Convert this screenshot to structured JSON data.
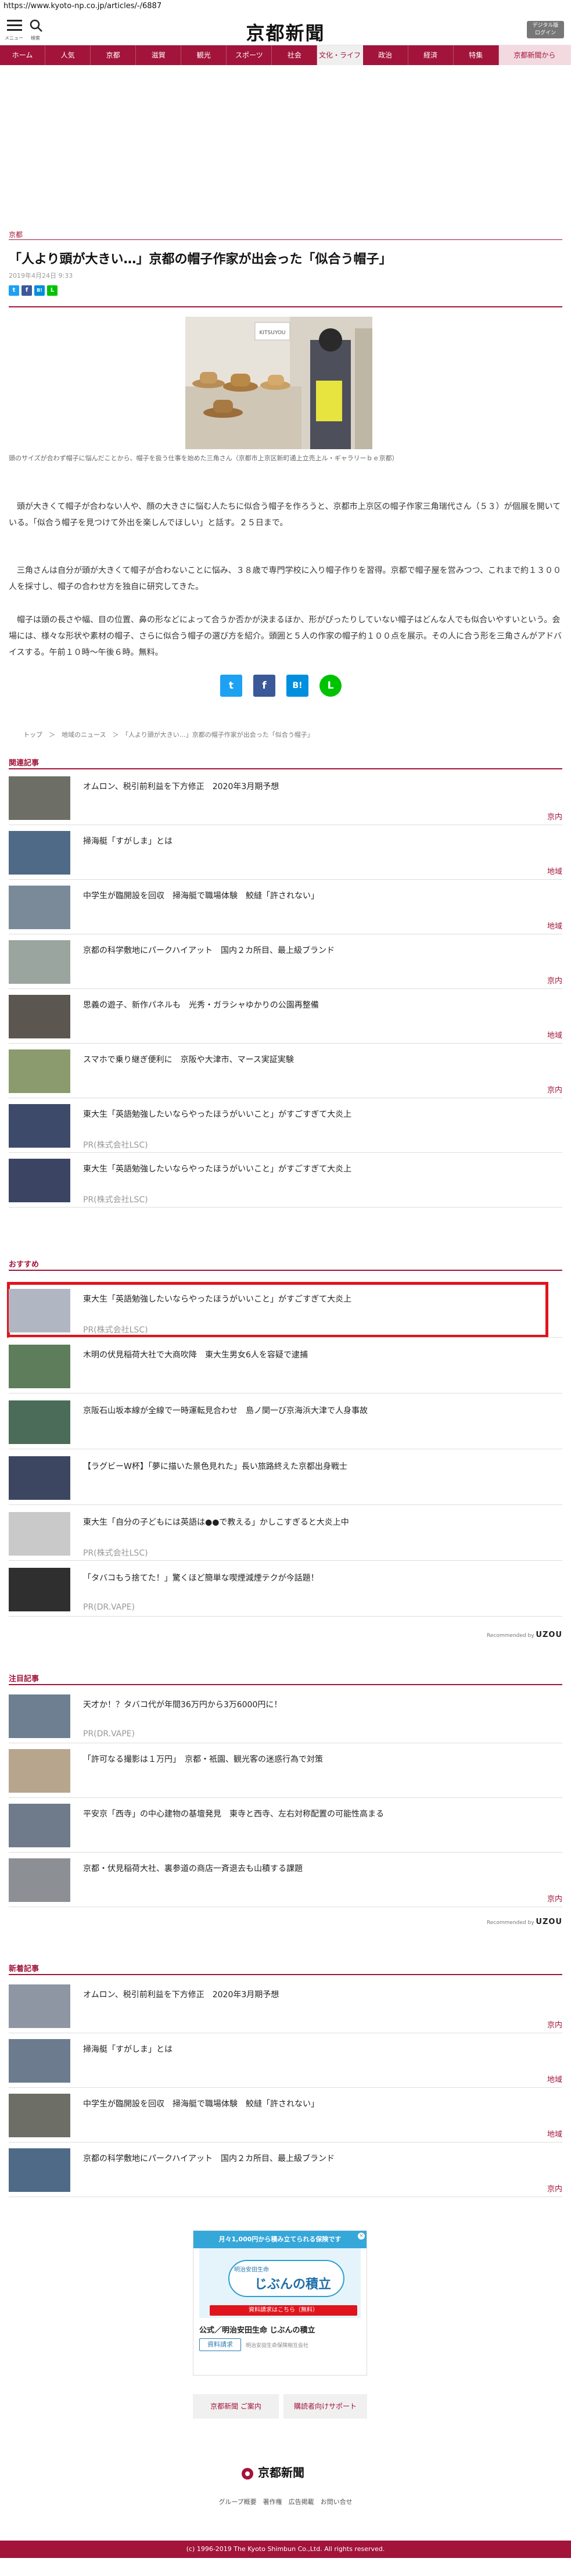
{
  "url": "https://www.kyoto-np.co.jp/articles/-/6887",
  "header": {
    "menu_label": "メニュー",
    "search_label": "検索",
    "logo": "京都新聞",
    "service_btn": "デジタル版\nログイン"
  },
  "nav": [
    "ホーム",
    "人気",
    "京都",
    "滋賀",
    "観光",
    "スポーツ",
    "社会",
    "文化・ライフ",
    "政治",
    "経済",
    "特集",
    "京都新聞から"
  ],
  "article": {
    "category": "京都",
    "title": "「人より頭が大きい…」京都の帽子作家が出会った「似合う帽子」",
    "date": "2019年4月24日 9:33",
    "share": [
      "t",
      "f",
      "B!",
      "L"
    ],
    "photo_sign": "KITSUYOU",
    "caption": "頭のサイズが合わず帽子に悩んだことから、帽子を扱う仕事を始めた三角さん（京都市上京区新町通上立売上ル・ギャラリーｂｅ京都）",
    "paragraphs": [
      "　頭が大きくて帽子が合わない人や、顔の大きさに悩む人たちに似合う帽子を作ろうと、京都市上京区の帽子作家三角瑞代さん（５３）が個展を開いている。「似合う帽子を見つけて外出を楽しんでほしい」と話す。２５日まで。",
      "　三角さんは自分が頭が大きくて帽子が合わないことに悩み、３８歳で専門学校に入り帽子作りを習得。京都で帽子屋を営みつつ、これまで約１３００人を採寸し、帽子の合わせ方を独自に研究してきた。",
      "　帽子は頭の長さや幅、目の位置、鼻の形などによって合うか否かが決まるほか、形がぴったりしていない帽子はどんな人でも似合いやすいという。会場には、様々な形状や素材の帽子、さらに似合う帽子の選び方を紹介。頭囲と５人の作家の帽子約１００点を展示。その人に合う形を三角さんがアドバイスする。午前１０時～午後６時。無料。"
    ],
    "share_big": [
      "t",
      "f",
      "B!",
      "L"
    ],
    "breadcrumb": "トップ　＞　地域のニュース　＞　「人より頭が大きい…」京都の帽子作家が出会った「似合う帽子」"
  },
  "related": {
    "heading": "関連記事",
    "items": [
      {
        "title": "オムロン、税引前利益を下方修正　2020年3月期予想",
        "sub": "",
        "tag": "京内"
      },
      {
        "title": "掃海艇「すがしま」とは",
        "sub": "",
        "tag": "地域"
      },
      {
        "title": "中学生が臨開設を回収　掃海艇で職場体験　鮫縫「許されない」",
        "sub": "",
        "tag": "地域"
      },
      {
        "title": "京都の科学敷地にパークハイアット　国内２カ所目、最上級ブランド",
        "sub": "",
        "tag": "京内"
      },
      {
        "title": "思義の遊子、新作パネルも　光秀・ガラシャゆかりの公園再整備",
        "sub": "",
        "tag": "地域"
      },
      {
        "title": "スマホで乗り継ぎ便利に　京阪や大津市、マース実証実験",
        "sub": "",
        "tag": "京内"
      },
      {
        "title": "東大生「英語勉強したいならやったほうがいいこと」がすごすぎて大炎上",
        "sub": "PR(株式会社LSC)",
        "tag": ""
      },
      {
        "title": "東大生「英語勉強したいならやったほうがいいこと」がすごすぎて大炎上",
        "sub": "PR(株式会社LSC)",
        "tag": ""
      }
    ]
  },
  "recommend": {
    "heading": "おすすめ",
    "items": [
      {
        "title": "東大生「英語勉強したいならやったほうがいいこと」がすごすぎて大炎上",
        "sub": "PR(株式会社LSC)"
      },
      {
        "title": "木明の伏見稲荷大社で大商吹降　東大生男女6人を容疑で逮捕",
        "sub": ""
      },
      {
        "title": "京阪石山坂本線が全線で一時運転見合わせ　島ノ関一び京海浜大津で人身事故",
        "sub": ""
      },
      {
        "title": "【ラグビーW杯】「夢に描いた景色見れた」長い旅路終えた京都出身戦士",
        "sub": ""
      },
      {
        "title": "東大生「自分の子どもには英語は●●で教える」かしこすぎると大炎上中",
        "sub": "PR(株式会社LSC)"
      },
      {
        "title": "「タバコもう捨てた！」驚くほど簡単な喫煙減煙テクが今話題！",
        "sub": "PR(DR.VAPE)"
      }
    ],
    "powered_label": "Recommended by",
    "powered_brand": "UZOU"
  },
  "attention": {
    "heading": "注目記事",
    "items": [
      {
        "title": "天才か！？タバコ代が年間36万円から3万6000円に！",
        "sub": "PR(DR.VAPE)",
        "tag": ""
      },
      {
        "title": "「許可なる撮影は１万円」　京都・祇園、観光客の迷惑行為で対策",
        "sub": "",
        "tag": ""
      },
      {
        "title": "平安京「西寺」の中心建物の基壇発見　東寺と西寺、左右対称配置の可能性高まる",
        "sub": "",
        "tag": ""
      },
      {
        "title": "京都・伏見稲荷大社、裏参道の商店一斉退去も山積する課題",
        "sub": "",
        "tag": "京内"
      }
    ],
    "powered_label": "Recommended by",
    "powered_brand": "UZOU"
  },
  "latest": {
    "heading": "新着記事",
    "items": [
      {
        "title": "オムロン、税引前利益を下方修正　2020年3月期予想",
        "tag": "京内"
      },
      {
        "title": "掃海艇「すがしま」とは",
        "tag": "地域"
      },
      {
        "title": "中学生が臨開設を回収　掃海艇で職場体験　鮫縫「許されない」",
        "tag": "地域"
      },
      {
        "title": "京都の科学敷地にパークハイアット　国内２カ所目、最上級ブランド",
        "tag": "京内"
      }
    ]
  },
  "ad": {
    "headline": "月々1,000円から積み立てられる保険です",
    "brand": "明治安田生命",
    "product": "じぶんの積立",
    "badge": "資料請求はこちら（無料）",
    "name": "公式／明治安田生命 じぶんの積立",
    "cta": "資料請求",
    "company": "明治安田生命保険相互会社"
  },
  "footer": {
    "btn1": "京都新聞 ご案内",
    "btn2": "購読者向けサポート",
    "logo": "京都新聞",
    "links": "グループ概要　著作権　広告掲載　お問い合せ",
    "copyright": "(c) 1996-2019 The Kyoto Shimbun Co.,Ltd. All rights reserved."
  },
  "colors": {
    "brand": "#a2143a",
    "highlight": "#e0141c",
    "twitter": "#1da1f2",
    "facebook": "#3b5998",
    "hatena": "#008fde",
    "line": "#00c300"
  }
}
